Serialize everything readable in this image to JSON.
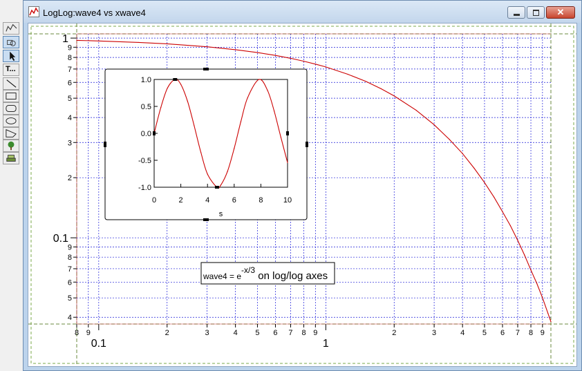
{
  "window": {
    "title": "LogLog:wave4 vs xwave4",
    "icon": "graph-window-icon"
  },
  "palette": {
    "tools": [
      {
        "name": "graph-tool-icon"
      },
      {
        "name": "draw-mode-icon"
      },
      {
        "name": "arrow-select-icon"
      },
      {
        "name": "text-tool-icon",
        "label": "T..."
      },
      {
        "name": "line-tool-icon"
      },
      {
        "name": "rectangle-tool-icon"
      },
      {
        "name": "rounded-rect-tool-icon"
      },
      {
        "name": "oval-tool-icon"
      },
      {
        "name": "polygon-tool-icon"
      },
      {
        "name": "tree-tool-icon"
      },
      {
        "name": "layer-tool-icon"
      }
    ]
  },
  "chart_data": [
    {
      "type": "line",
      "title": "",
      "xlabel": "",
      "ylabel": "",
      "xscale": "log",
      "yscale": "log",
      "xlim": [
        0.08,
        9.8
      ],
      "ylim": [
        0.037,
        1.05
      ],
      "grid": true,
      "x_ticks_major": [
        {
          "v": 0.1,
          "label": "0.1"
        },
        {
          "v": 1,
          "label": "1"
        }
      ],
      "x_ticks_minor": [
        {
          "v": 0.08,
          "label": "8"
        },
        {
          "v": 0.09,
          "label": "9"
        },
        {
          "v": 0.2,
          "label": "2"
        },
        {
          "v": 0.3,
          "label": "3"
        },
        {
          "v": 0.4,
          "label": "4"
        },
        {
          "v": 0.5,
          "label": "5"
        },
        {
          "v": 0.6,
          "label": "6"
        },
        {
          "v": 0.7,
          "label": "7"
        },
        {
          "v": 0.8,
          "label": "8"
        },
        {
          "v": 0.9,
          "label": "9"
        },
        {
          "v": 2,
          "label": "2"
        },
        {
          "v": 3,
          "label": "3"
        },
        {
          "v": 4,
          "label": "4"
        },
        {
          "v": 5,
          "label": "5"
        },
        {
          "v": 6,
          "label": "6"
        },
        {
          "v": 7,
          "label": "7"
        },
        {
          "v": 8,
          "label": "8"
        },
        {
          "v": 9,
          "label": "9"
        }
      ],
      "y_ticks_major": [
        {
          "v": 1,
          "label": "1"
        },
        {
          "v": 0.1,
          "label": "0.1"
        }
      ],
      "y_ticks_minor": [
        {
          "v": 0.9,
          "label": "9"
        },
        {
          "v": 0.8,
          "label": "8"
        },
        {
          "v": 0.7,
          "label": "7"
        },
        {
          "v": 0.6,
          "label": "6"
        },
        {
          "v": 0.5,
          "label": "5"
        },
        {
          "v": 0.4,
          "label": "4"
        },
        {
          "v": 0.3,
          "label": "3"
        },
        {
          "v": 0.2,
          "label": "2"
        },
        {
          "v": 0.09,
          "label": "9"
        },
        {
          "v": 0.08,
          "label": "8"
        },
        {
          "v": 0.07,
          "label": "7"
        },
        {
          "v": 0.06,
          "label": "6"
        },
        {
          "v": 0.05,
          "label": "5"
        },
        {
          "v": 0.04,
          "label": "4"
        }
      ],
      "series": [
        {
          "color": "#cc0000",
          "x": [
            0.08,
            0.1,
            0.15,
            0.2,
            0.3,
            0.4,
            0.5,
            0.6,
            0.7,
            0.8,
            0.9,
            1.0,
            1.25,
            1.5,
            1.75,
            2.0,
            2.5,
            3.0,
            3.5,
            4.0,
            4.5,
            5.0,
            5.5,
            6.0,
            6.5,
            7.0,
            7.5,
            8.0,
            8.5,
            9.0,
            9.5,
            9.8
          ],
          "y": [
            0.974,
            0.967,
            0.951,
            0.936,
            0.905,
            0.875,
            0.846,
            0.819,
            0.792,
            0.766,
            0.741,
            0.717,
            0.659,
            0.607,
            0.558,
            0.513,
            0.435,
            0.368,
            0.311,
            0.264,
            0.223,
            0.189,
            0.16,
            0.135,
            0.115,
            0.097,
            0.082,
            0.069,
            0.059,
            0.05,
            0.042,
            0.038
          ]
        }
      ],
      "annotation": {
        "prefix": "wave4 = e",
        "superscript": "-x/3",
        "suffix": " on log/log axes"
      }
    },
    {
      "type": "line",
      "title": "",
      "xlabel": "s",
      "ylabel": "",
      "xlim": [
        0,
        10
      ],
      "ylim": [
        -1,
        1
      ],
      "grid": false,
      "x_ticks": [
        {
          "v": 0,
          "label": "0"
        },
        {
          "v": 2,
          "label": "2"
        },
        {
          "v": 4,
          "label": "4"
        },
        {
          "v": 6,
          "label": "6"
        },
        {
          "v": 8,
          "label": "8"
        },
        {
          "v": 10,
          "label": "10"
        }
      ],
      "y_ticks": [
        {
          "v": 1,
          "label": "1.0"
        },
        {
          "v": 0.5,
          "label": "0.5"
        },
        {
          "v": 0,
          "label": "0.0"
        },
        {
          "v": -0.5,
          "label": "-0.5"
        },
        {
          "v": -1,
          "label": "-1.0"
        }
      ],
      "series": [
        {
          "color": "#cc0000",
          "x": [
            0,
            0.5,
            1.0,
            1.5708,
            2.0,
            2.5,
            3.0,
            3.5,
            4.0,
            4.7124,
            5.0,
            5.5,
            6.0,
            6.5,
            7.0,
            7.854,
            8.5,
            9.0,
            9.5,
            10.0
          ],
          "y": [
            0,
            0.479,
            0.841,
            1.0,
            0.909,
            0.598,
            0.141,
            -0.351,
            -0.757,
            -1.0,
            -0.959,
            -0.706,
            -0.279,
            0.215,
            0.657,
            1.0,
            0.798,
            0.412,
            -0.075,
            -0.544
          ]
        }
      ]
    }
  ]
}
